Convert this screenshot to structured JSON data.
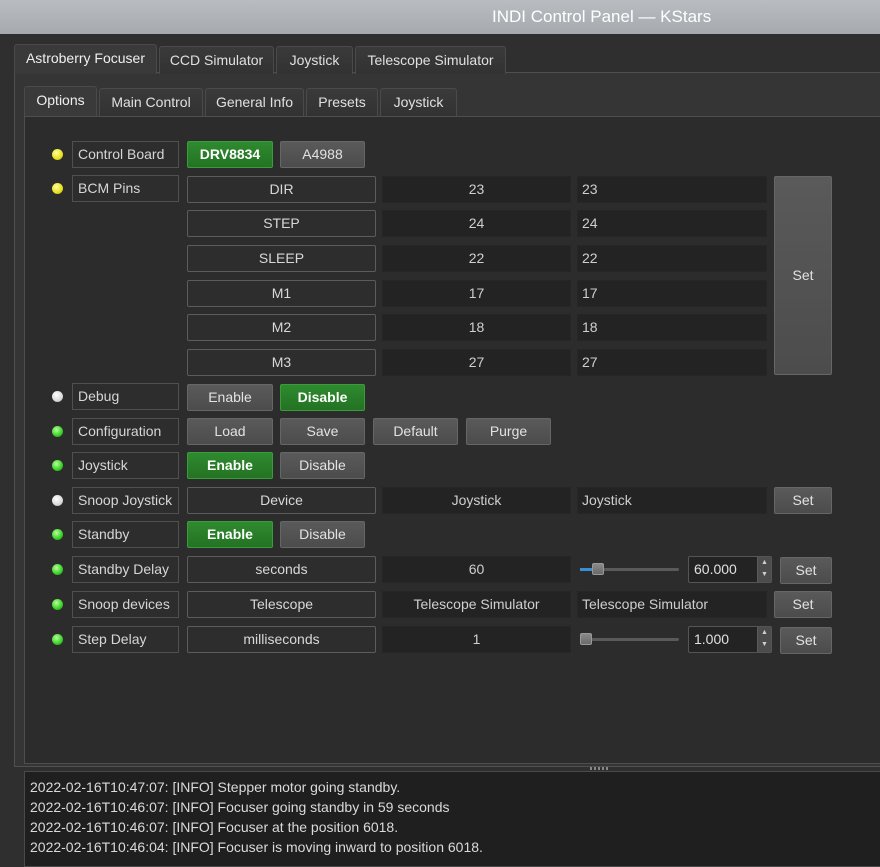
{
  "window": {
    "title": "INDI Control Panel — KStars"
  },
  "device_tabs": [
    {
      "label": "Astroberry Focuser",
      "active": true
    },
    {
      "label": "CCD Simulator",
      "active": false
    },
    {
      "label": "Joystick",
      "active": false
    },
    {
      "label": "Telescope Simulator",
      "active": false
    }
  ],
  "group_tabs": [
    {
      "label": "Options",
      "active": true
    },
    {
      "label": "Main Control",
      "active": false
    },
    {
      "label": "General Info",
      "active": false
    },
    {
      "label": "Presets",
      "active": false
    },
    {
      "label": "Joystick",
      "active": false
    }
  ],
  "colors": {
    "led_yellow": "#e6df1e",
    "led_green": "#36d024",
    "led_white": "#d9d9d9",
    "button_on": "#2f8a2f"
  },
  "properties": {
    "control_board": {
      "label": "Control Board",
      "status": "yellow",
      "options": [
        "DRV8834",
        "A4988"
      ],
      "selected": "DRV8834"
    },
    "bcm_pins": {
      "label": "BCM Pins",
      "status": "yellow",
      "set_label": "Set",
      "rows": [
        {
          "name": "DIR",
          "current": "23",
          "input": "23"
        },
        {
          "name": "STEP",
          "current": "24",
          "input": "24"
        },
        {
          "name": "SLEEP",
          "current": "22",
          "input": "22"
        },
        {
          "name": "M1",
          "current": "17",
          "input": "17"
        },
        {
          "name": "M2",
          "current": "18",
          "input": "18"
        },
        {
          "name": "M3",
          "current": "27",
          "input": "27"
        }
      ]
    },
    "debug": {
      "label": "Debug",
      "status": "white",
      "enable": "Enable",
      "disable": "Disable",
      "selected": "Disable"
    },
    "configuration": {
      "label": "Configuration",
      "status": "green",
      "buttons": [
        "Load",
        "Save",
        "Default",
        "Purge"
      ]
    },
    "joystick": {
      "label": "Joystick",
      "status": "green",
      "enable": "Enable",
      "disable": "Disable",
      "selected": "Enable"
    },
    "snoop_joystick": {
      "label": "Snoop Joystick",
      "status": "white",
      "name": "Device",
      "current": "Joystick",
      "input": "Joystick",
      "set_label": "Set"
    },
    "standby": {
      "label": "Standby",
      "status": "green",
      "enable": "Enable",
      "disable": "Disable",
      "selected": "Enable"
    },
    "standby_delay": {
      "label": "Standby Delay",
      "status": "green",
      "name": "seconds",
      "current": "60",
      "slider_fraction": 0.05,
      "spin_value": "60.000",
      "set_label": "Set"
    },
    "snoop_devices": {
      "label": "Snoop devices",
      "status": "green",
      "name": "Telescope",
      "current": "Telescope Simulator",
      "input": "Telescope Simulator",
      "set_label": "Set"
    },
    "step_delay": {
      "label": "Step Delay",
      "status": "green",
      "name": "milliseconds",
      "current": "1",
      "slider_fraction": 0.0,
      "spin_value": "1.000",
      "set_label": "Set"
    }
  },
  "log": [
    "2022-02-16T10:47:07: [INFO] Stepper motor going standby.",
    "2022-02-16T10:46:07: [INFO] Focuser going standby in 59 seconds",
    "2022-02-16T10:46:07: [INFO] Focuser at the position 6018.",
    "2022-02-16T10:46:04: [INFO] Focuser is moving inward to position 6018."
  ]
}
